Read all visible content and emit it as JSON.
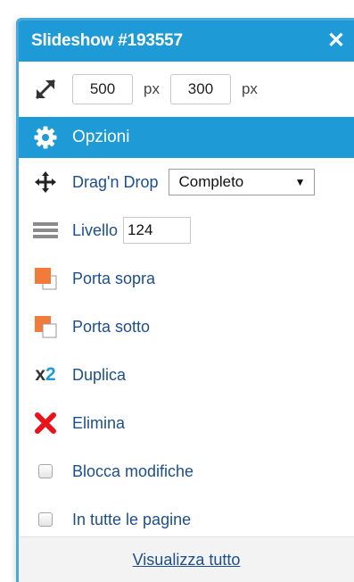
{
  "window": {
    "title": "Slideshow #193557",
    "close_icon": "close-icon"
  },
  "size": {
    "width_value": "500",
    "width_unit": "px",
    "height_value": "300",
    "height_unit": "px",
    "icon": "resize-icon"
  },
  "options": {
    "label": "Opzioni",
    "icon": "gear-icon"
  },
  "menu": {
    "drag": {
      "label": "Drag'n Drop",
      "select_value": "Completo",
      "icon": "move-icon"
    },
    "level": {
      "label": "Livello",
      "value": "124",
      "icon": "layers-icon"
    },
    "bring_front": {
      "label": "Porta sopra",
      "icon": "bring-front-icon"
    },
    "send_back": {
      "label": "Porta sotto",
      "icon": "send-back-icon"
    },
    "duplicate": {
      "label": "Duplica",
      "icon_text": "x2"
    },
    "delete": {
      "label": "Elimina",
      "icon": "delete-icon"
    },
    "lock": {
      "label": "Blocca modifiche",
      "checked": false
    },
    "all_pages": {
      "label": "In tutte le pagine",
      "checked": false
    }
  },
  "footer": {
    "link": "Visualizza tutto"
  },
  "colors": {
    "accent": "#1e9ad6",
    "label": "#1d4f8a",
    "orange": "#f07b3a",
    "red": "#e8141b",
    "border": "#4aa8d8"
  }
}
